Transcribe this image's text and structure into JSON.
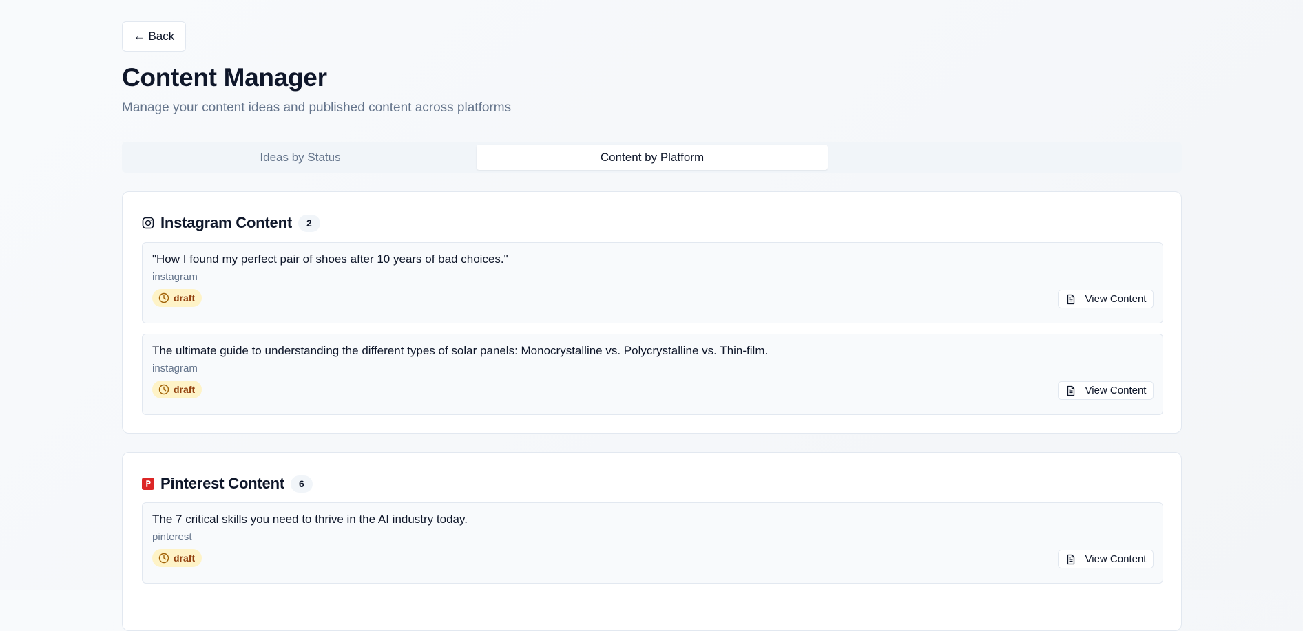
{
  "nav": {
    "back_label": "← Back"
  },
  "header": {
    "title": "Content Manager",
    "subtitle": "Manage your content ideas and published content across platforms"
  },
  "tabs": [
    {
      "label": "Ideas by Status",
      "active": false
    },
    {
      "label": "Content by Platform",
      "active": true
    }
  ],
  "sections": [
    {
      "title": "Instagram Content",
      "count": "2",
      "icon": "instagram-icon",
      "items": [
        {
          "title": "\"How I found my perfect pair of shoes after 10 years of bad choices.\"",
          "platform": "instagram",
          "status": "draft",
          "action": "View Content"
        },
        {
          "title": "The ultimate guide to understanding the different types of solar panels: Monocrystalline vs. Polycrystalline vs. Thin-film.",
          "platform": "instagram",
          "status": "draft",
          "action": "View Content"
        }
      ]
    },
    {
      "title": "Pinterest Content",
      "count": "6",
      "icon": "pinterest-icon",
      "items": [
        {
          "title": "The 7 critical skills you need to thrive in the AI industry today.",
          "platform": "pinterest",
          "status": "draft",
          "action": "View Content"
        }
      ]
    }
  ],
  "colors": {
    "draft_badge_bg": "#fef3c7",
    "draft_badge_text": "#92400e",
    "pinterest_brand": "#dc2626",
    "active_tab_bg": "#ffffff"
  }
}
